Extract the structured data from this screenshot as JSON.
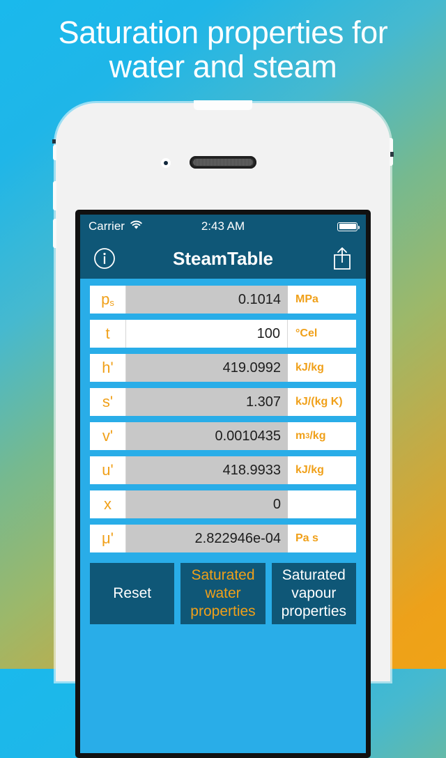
{
  "headline": {
    "line1": "Saturation properties for",
    "line2": "water and steam"
  },
  "colors": {
    "accent_orange": "#f0a019",
    "nav_dark_blue": "#0f5777",
    "screen_blue": "#29ade8",
    "readonly_gray": "#c8c8c8"
  },
  "status_bar": {
    "carrier": "Carrier",
    "wifi_icon": "wifi-icon",
    "time": "2:43 AM",
    "battery_icon": "battery-icon"
  },
  "nav_bar": {
    "info_icon": "info-circle-icon",
    "title": "SteamTable",
    "share_icon": "share-icon"
  },
  "table": {
    "rows": [
      {
        "symbol": "p",
        "subscript": "s",
        "value": "0.1014",
        "unit": "MPa",
        "editable": false
      },
      {
        "symbol": "t",
        "subscript": "",
        "value": "100",
        "unit": "°Cel",
        "editable": true
      },
      {
        "symbol": "h'",
        "subscript": "",
        "value": "419.0992",
        "unit": "kJ/kg",
        "editable": false
      },
      {
        "symbol": "s'",
        "subscript": "",
        "value": "1.307",
        "unit": "kJ/(kg K)",
        "editable": false
      },
      {
        "symbol": "v'",
        "subscript": "",
        "value": "0.0010435",
        "unit": "m³/kg",
        "editable": false
      },
      {
        "symbol": "u'",
        "subscript": "",
        "value": "418.9933",
        "unit": "kJ/kg",
        "editable": false
      },
      {
        "symbol": "x",
        "subscript": "",
        "value": "0",
        "unit": "",
        "editable": false
      },
      {
        "symbol": "μ'",
        "subscript": "",
        "value": "2.822946e-04",
        "unit": "Pa s",
        "editable": false
      }
    ]
  },
  "buttons": {
    "reset": "Reset",
    "saturated_water": "Saturated water properties",
    "saturated_vapour": "Saturated vapour properties"
  }
}
